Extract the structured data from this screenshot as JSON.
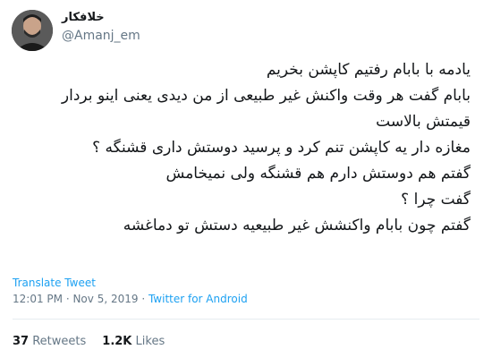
{
  "author": {
    "name": "خلافکار",
    "handle": "@Amanj_em"
  },
  "tweet": {
    "lines": [
      "یادمه با بابام رفتیم کاپشن بخریم",
      "بابام گفت هر وقت واکنش غیر طبیعی از من دیدی یعنی اینو بردار قیمتش بالاست",
      "مغازه دار یه کاپشن تنم کرد و پرسید دوستش داری قشنگه ؟",
      "گفتم هم دوستش دارم هم قشنگه ولی نمیخامش",
      "گفت چرا ؟",
      "گفتم چون بابام واکنشش غیر طبیعیه دستش تو دماغشه"
    ]
  },
  "translate_label": "Translate Tweet",
  "meta": {
    "time": "12:01 PM",
    "separator": " · ",
    "date": "Nov 5, 2019",
    "source": "Twitter for Android"
  },
  "stats": {
    "retweets_count": "37",
    "retweets_label": "Retweets",
    "likes_count": "1.2K",
    "likes_label": "Likes"
  }
}
